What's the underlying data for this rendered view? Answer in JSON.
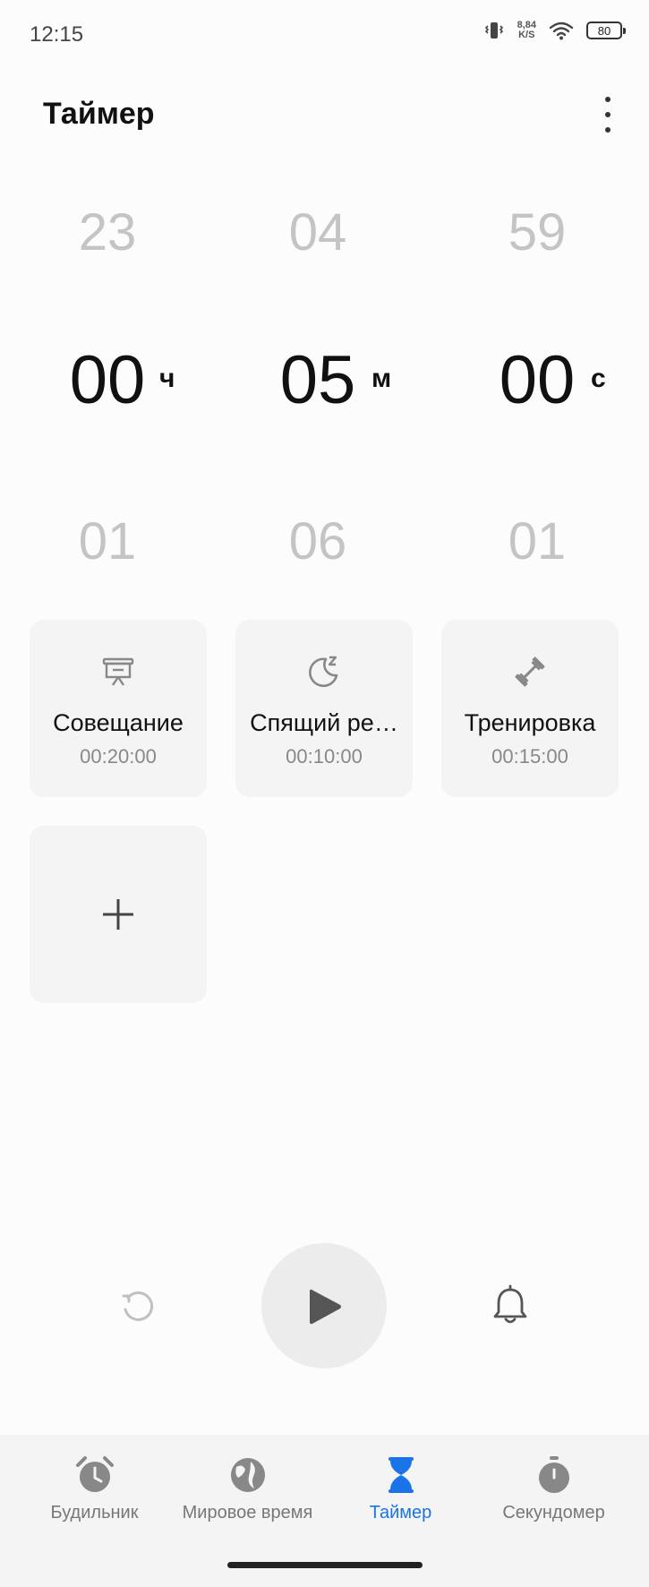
{
  "status_bar": {
    "time": "12:15",
    "net_speed_value": "8,84",
    "net_speed_unit": "K/S",
    "battery_level": "80"
  },
  "header": {
    "title": "Таймер"
  },
  "picker": {
    "hours": {
      "prev": "23",
      "current": "00",
      "next": "01",
      "unit": "ч"
    },
    "minutes": {
      "prev": "04",
      "current": "05",
      "next": "06",
      "unit": "м"
    },
    "seconds": {
      "prev": "59",
      "current": "00",
      "next": "01",
      "unit": "с"
    }
  },
  "presets": [
    {
      "name": "Совещание",
      "duration": "00:20:00",
      "icon": "presentation-icon"
    },
    {
      "name": "Спящий ре…",
      "duration": "00:10:00",
      "icon": "moon-sleep-icon"
    },
    {
      "name": "Тренировка",
      "duration": "00:15:00",
      "icon": "dumbbell-icon"
    }
  ],
  "controls": {
    "reset_icon": "reset-icon",
    "play_icon": "play-icon",
    "sound_icon": "bell-icon"
  },
  "nav": {
    "items": [
      {
        "label": "Будильник",
        "icon": "alarm-clock-icon",
        "active": false
      },
      {
        "label": "Мировое время",
        "icon": "globe-icon",
        "active": false
      },
      {
        "label": "Таймер",
        "icon": "hourglass-icon",
        "active": true
      },
      {
        "label": "Секундомер",
        "icon": "stopwatch-icon",
        "active": false
      }
    ]
  },
  "colors": {
    "accent": "#1a73e8",
    "background": "#fcfcfc",
    "card": "#f4f4f4",
    "muted_digit": "#c4c4c4"
  }
}
